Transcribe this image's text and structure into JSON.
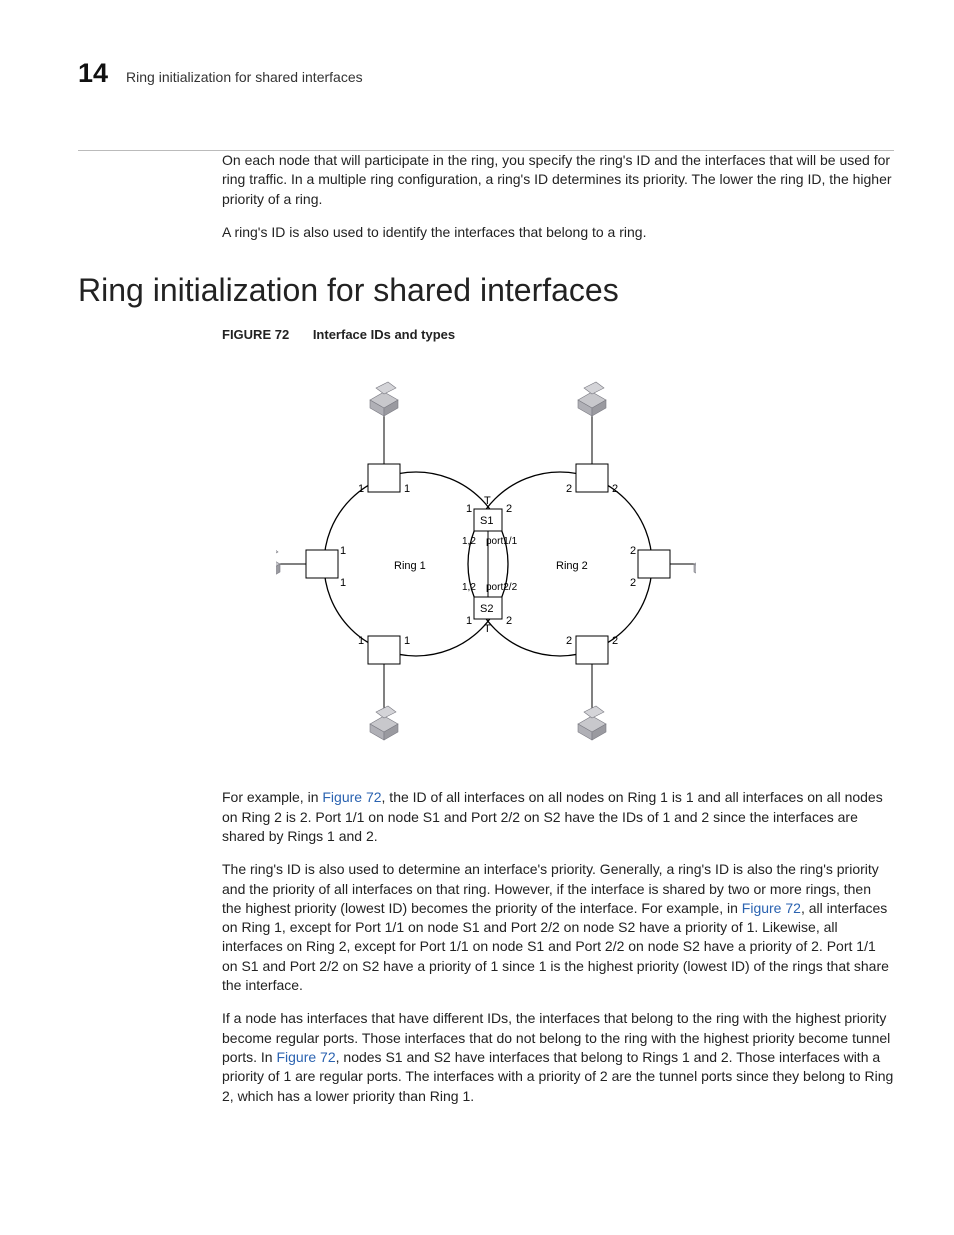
{
  "header": {
    "page_number": "14",
    "running_title": "Ring initialization for shared interfaces"
  },
  "intro": {
    "p1": "On each node that will participate in the ring, you specify the ring's ID and the interfaces that will be used for ring traffic. In a multiple ring configuration, a ring's ID determines its priority. The lower the ring ID, the higher priority of a ring.",
    "p2": "A ring's ID is also used to identify the interfaces that belong to a ring."
  },
  "section_title": "Ring initialization for shared interfaces",
  "figure": {
    "label": "FIGURE 72",
    "title": "Interface IDs and types"
  },
  "diagram": {
    "ring1": "Ring 1",
    "ring2": "Ring 2",
    "s1": "S1",
    "s2": "S2",
    "top_T": "T",
    "bottom_T": "T",
    "port_top": "port1/1",
    "port_bottom": "port2/2",
    "one": "1",
    "two": "2",
    "onetwo": "1,2"
  },
  "after": {
    "p1a": "For example, in ",
    "p1link": "Figure 72",
    "p1b": ", the ID of all interfaces on all nodes on Ring 1 is 1 and all interfaces on all nodes on Ring 2 is 2. Port 1/1 on node S1 and Port 2/2 on S2 have the IDs of 1 and 2 since the interfaces are shared by Rings 1 and 2.",
    "p2a": "The ring's ID is also used to determine an interface's priority. Generally, a ring's ID is also the ring's priority and the priority of all interfaces on that ring. However, if the interface is shared by two or more rings, then the highest priority (lowest ID) becomes the priority of the interface. For example, in ",
    "p2link": "Figure 72",
    "p2b": ", all interfaces on Ring 1, except for Port 1/1 on node S1 and Port 2/2 on node S2 have a priority of 1. Likewise, all interfaces on Ring 2, except for Port 1/1 on node S1 and Port 2/2 on node S2 have a priority of 2. Port 1/1 on S1 and Port 2/2 on S2 have a priority of 1 since 1 is the highest priority (lowest ID) of the rings that share the interface.",
    "p3a": "If a node has interfaces that have different IDs, the interfaces that belong to the ring with the highest priority become regular ports. Those interfaces that do not belong to the ring with the highest priority become tunnel ports. In ",
    "p3link": "Figure 72",
    "p3b": ", nodes S1 and S2 have interfaces that belong to Rings 1 and 2. Those interfaces with a priority of 1 are regular ports. The interfaces with a priority of 2 are the tunnel ports since they belong to Ring 2, which has a lower priority than Ring 1."
  }
}
